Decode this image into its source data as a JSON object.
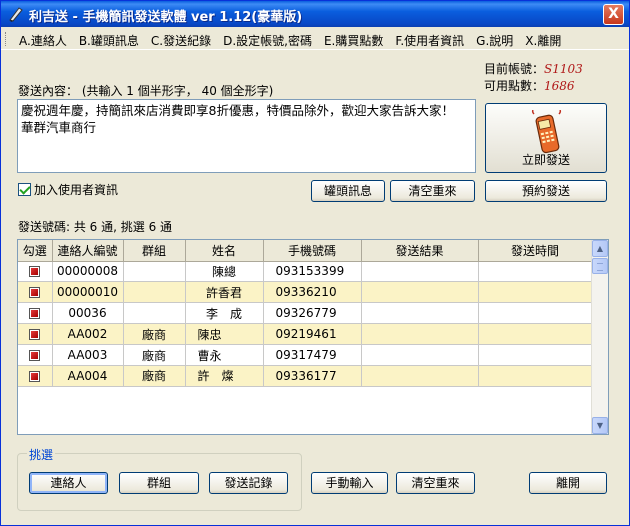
{
  "window": {
    "title": "利吉送 - 手機簡訊發送軟體 ver 1.12(豪華版)",
    "close_label": "X"
  },
  "menu": {
    "items": [
      "A.連絡人",
      "B.罐頭訊息",
      "C.發送紀錄",
      "D.設定帳號,密碼",
      "E.購買點數",
      "F.使用者資訊",
      "G.說明",
      "X.離開"
    ]
  },
  "account": {
    "account_label": "目前帳號：",
    "account_value": "S1103",
    "points_label": "可用點數：",
    "points_value": "1686"
  },
  "message": {
    "label": "發送內容：  (共輸入 1 個半形字， 40 個全形字)",
    "content": "慶祝週年慶，持簡訊來店消費即享8折優惠，特價品除外，歡迎大家告訴大家！\n華群汽車商行"
  },
  "buttons": {
    "send_now": "立即發送",
    "canned": "罐頭訊息",
    "clear_top": "清空重來",
    "schedule": "預約發送",
    "contacts": "連絡人",
    "group": "群組",
    "history": "發送記錄",
    "manual": "手動輸入",
    "clear_bottom": "清空重來",
    "exit": "離開"
  },
  "options": {
    "add_user_info": "加入使用者資訊"
  },
  "recipients": {
    "summary": "發送號碼: 共 6 通, 挑選 6 通",
    "columns": [
      "勾選",
      "連絡人編號",
      "群組",
      "姓名",
      "手機號碼",
      "發送結果",
      "發送時間"
    ],
    "rows": [
      {
        "id": "00000008",
        "group": "",
        "name": "陳總",
        "phone": "093153399",
        "result": "",
        "time": ""
      },
      {
        "id": "00000010",
        "group": "",
        "name": "許香君",
        "phone": "09336210",
        "result": "",
        "time": ""
      },
      {
        "id": "00036",
        "group": "",
        "name": "李　成",
        "phone": "09326779",
        "result": "",
        "time": ""
      },
      {
        "id": "AA002",
        "group": "廠商",
        "name": "陳忠",
        "phone": "09219461",
        "result": "",
        "time": ""
      },
      {
        "id": "AA003",
        "group": "廠商",
        "name": "曹永",
        "phone": "09317479",
        "result": "",
        "time": ""
      },
      {
        "id": "AA004",
        "group": "廠商",
        "name": "許　燦",
        "phone": "09336177",
        "result": "",
        "time": ""
      }
    ]
  },
  "select_group": {
    "title": "挑選"
  },
  "colors": {
    "title_bar": "#0a5ede",
    "row_highlight": "#fbf3c6",
    "account_value": "#b01818",
    "group_title": "#0046d5"
  }
}
